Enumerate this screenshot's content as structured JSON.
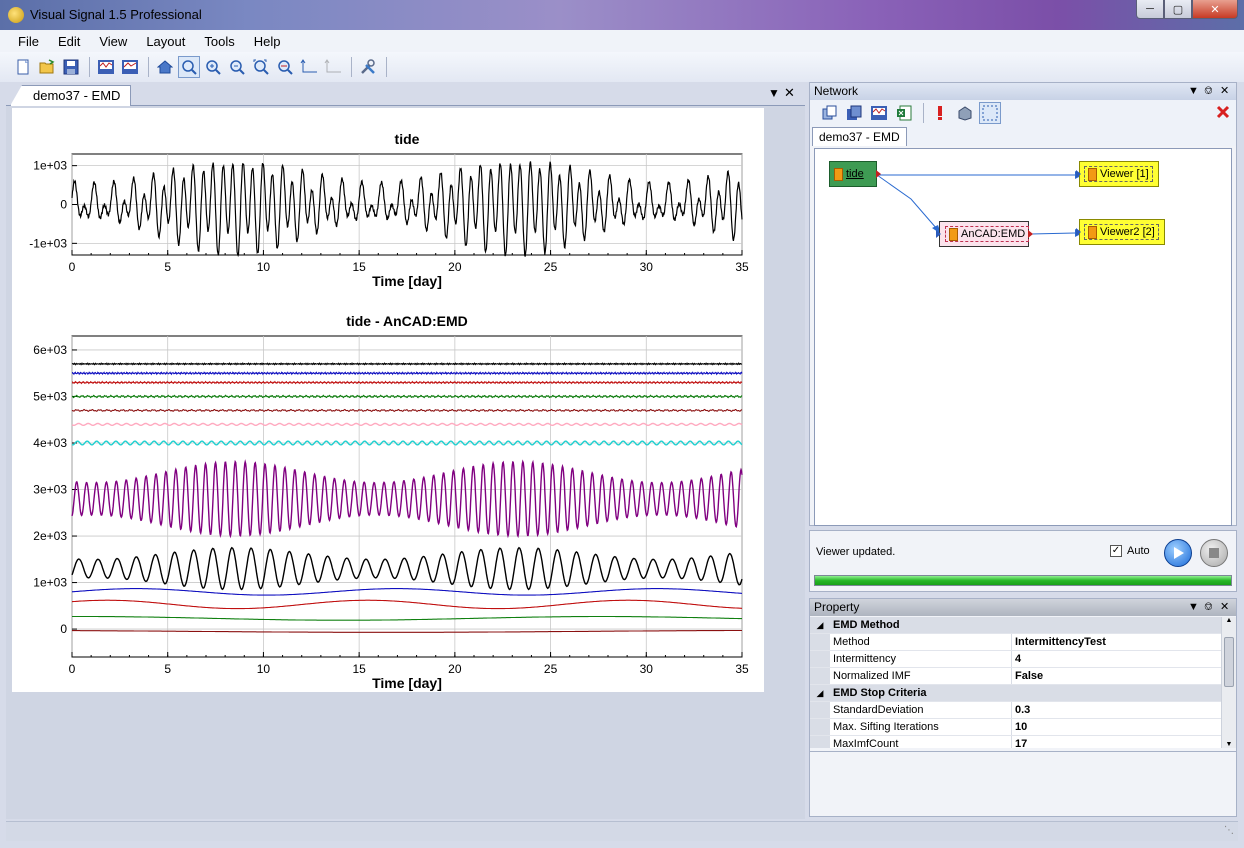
{
  "window": {
    "title": "Visual Signal 1.5 Professional"
  },
  "menu": {
    "items": [
      "File",
      "Edit",
      "View",
      "Layout",
      "Tools",
      "Help"
    ]
  },
  "document": {
    "tab_label": "demo37 - EMD"
  },
  "network": {
    "title": "Network",
    "tab_label": "demo37 - EMD",
    "nodes": {
      "source": "tide",
      "processor": "AnCAD:EMD",
      "viewer1": "Viewer [1]",
      "viewer2": "Viewer2 [2]"
    }
  },
  "status": {
    "message": "Viewer updated.",
    "auto_label": "Auto",
    "auto_checked": true,
    "progress": 1.0
  },
  "property": {
    "title": "Property",
    "groups": [
      {
        "name": "EMD Method",
        "rows": [
          {
            "key": "Method",
            "value": "IntermittencyTest"
          },
          {
            "key": "Intermittency",
            "value": "4"
          },
          {
            "key": "Normalized IMF",
            "value": "False"
          }
        ]
      },
      {
        "name": "EMD Stop Criteria",
        "rows": [
          {
            "key": "StandardDeviation",
            "value": "0.3"
          },
          {
            "key": "Max. Sifting Iterations",
            "value": "10"
          },
          {
            "key": "MaxImfCount",
            "value": "17"
          }
        ]
      }
    ]
  },
  "icons": {
    "toolbar": [
      "new-file-icon",
      "open-folder-icon",
      "save-icon",
      "signal-view-icon",
      "signal-export-icon",
      "home-icon",
      "zoom-select-icon",
      "zoom-in-icon",
      "zoom-out-icon",
      "zoom-fit-icon",
      "zoom-x-icon",
      "axis-scale-icon",
      "axis-scale-disabled-icon",
      "tools-icon"
    ],
    "network_toolbar": [
      "add-node-icon",
      "copy-node-icon",
      "signal-node-icon",
      "excel-icon",
      "alert-icon",
      "refresh-icon",
      "select-icon",
      "delete-icon"
    ]
  },
  "chart_data": [
    {
      "type": "line",
      "title": "tide",
      "xlabel": "Time [day]",
      "ylabel": "",
      "xlim": [
        0,
        35
      ],
      "ylim": [
        -1300,
        1300
      ],
      "x_ticks": [
        0,
        5,
        10,
        15,
        20,
        25,
        30,
        35
      ],
      "y_ticks": [
        {
          "value": 1000,
          "label": "1e+03"
        },
        {
          "value": 0,
          "label": "0"
        },
        {
          "value": -1000,
          "label": "-1e+03"
        }
      ],
      "grid": true,
      "series": [
        {
          "color": "#000000",
          "description": "semidiurnal tidal signal with spring-neap modulation, amplitude up to ~1200"
        }
      ]
    },
    {
      "type": "line",
      "title": "tide - AnCAD:EMD",
      "xlabel": "Time [day]",
      "ylabel": "",
      "xlim": [
        0,
        35
      ],
      "ylim": [
        -600,
        6300
      ],
      "x_ticks": [
        0,
        5,
        10,
        15,
        20,
        25,
        30,
        35
      ],
      "y_ticks": [
        {
          "value": 6000,
          "label": "6e+03"
        },
        {
          "value": 5000,
          "label": "5e+03"
        },
        {
          "value": 4000,
          "label": "4e+03"
        },
        {
          "value": 3000,
          "label": "3e+03"
        },
        {
          "value": 2000,
          "label": "2e+03"
        },
        {
          "value": 1000,
          "label": "1e+03"
        },
        {
          "value": 0,
          "label": "0"
        }
      ],
      "grid": true,
      "series": [
        {
          "offset": 5700,
          "amp": 15,
          "period": 0.1,
          "color": "#000000"
        },
        {
          "offset": 5500,
          "amp": 20,
          "period": 0.15,
          "color": "#1010c0"
        },
        {
          "offset": 5300,
          "amp": 20,
          "period": 0.2,
          "color": "#c01010"
        },
        {
          "offset": 5000,
          "amp": 25,
          "period": 0.3,
          "color": "#108010"
        },
        {
          "offset": 4700,
          "amp": 20,
          "period": 0.4,
          "color": "#8b1010"
        },
        {
          "offset": 4400,
          "amp": 20,
          "period": 0.5,
          "color": "#ffaac0"
        },
        {
          "offset": 4000,
          "amp": 40,
          "period": 0.5,
          "color": "#20d0d0"
        },
        {
          "offset": 2800,
          "amp_min": 350,
          "amp_max": 800,
          "period": 0.518,
          "color": "#800080"
        },
        {
          "offset": 1300,
          "amp_min": 200,
          "amp_max": 450,
          "period": 1.0,
          "color": "#000000"
        },
        {
          "offset": 800,
          "amp": 70,
          "period": 13.6,
          "color": "#1010c0"
        },
        {
          "offset": 530,
          "amp": 90,
          "period": 13.6,
          "color": "#c01010"
        },
        {
          "offset": 230,
          "amp": 40,
          "period": 27,
          "color": "#108010"
        },
        {
          "offset": -50,
          "amp": 20,
          "period": 40,
          "color": "#8b1010"
        }
      ]
    }
  ]
}
